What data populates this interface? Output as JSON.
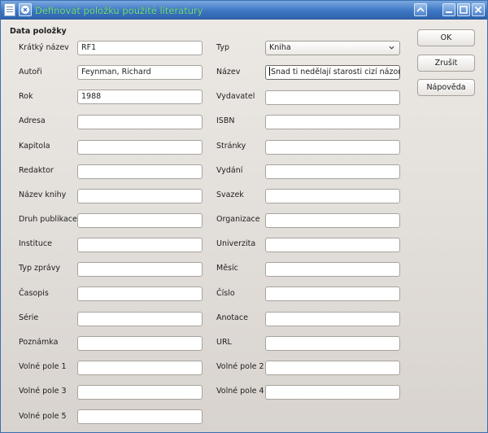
{
  "window": {
    "title": "Definovat položku použité literatury"
  },
  "section": {
    "title": "Data položky"
  },
  "left_fields": [
    {
      "label": "Krátký název",
      "value": "RF1"
    },
    {
      "label": "Autoři",
      "value": "Feynman, Richard"
    },
    {
      "label": "Rok",
      "value": "1988"
    },
    {
      "label": "Adresa",
      "value": ""
    },
    {
      "label": "Kapitola",
      "value": ""
    },
    {
      "label": "Redaktor",
      "value": ""
    },
    {
      "label": "Název knihy",
      "value": ""
    },
    {
      "label": "Druh publikace",
      "value": ""
    },
    {
      "label": "Instituce",
      "value": ""
    },
    {
      "label": "Typ zprávy",
      "value": ""
    },
    {
      "label": "Časopis",
      "value": ""
    },
    {
      "label": "Série",
      "value": ""
    },
    {
      "label": "Poznámka",
      "value": ""
    },
    {
      "label": "Volné pole 1",
      "value": ""
    },
    {
      "label": "Volné pole 3",
      "value": ""
    },
    {
      "label": "Volné pole 5",
      "value": ""
    }
  ],
  "right_fields": [
    {
      "label": "Typ",
      "value": "Kniha"
    },
    {
      "label": "Název",
      "value": "Snad ti nedělají starosti cizí názory"
    },
    {
      "label": "Vydavatel",
      "value": ""
    },
    {
      "label": "ISBN",
      "value": ""
    },
    {
      "label": "Stránky",
      "value": ""
    },
    {
      "label": "Vydání",
      "value": ""
    },
    {
      "label": "Svazek",
      "value": ""
    },
    {
      "label": "Organizace",
      "value": ""
    },
    {
      "label": "Univerzita",
      "value": ""
    },
    {
      "label": "Měsíc",
      "value": ""
    },
    {
      "label": "Číslo",
      "value": ""
    },
    {
      "label": "Anotace",
      "value": ""
    },
    {
      "label": "URL",
      "value": ""
    },
    {
      "label": "Volné pole 2",
      "value": ""
    },
    {
      "label": "Volné pole 4",
      "value": ""
    }
  ],
  "buttons": {
    "ok": "OK",
    "cancel": "Zrušit",
    "help": "Nápověda"
  },
  "icons": {
    "app": "document-icon",
    "menu": "close-circle-icon",
    "shade": "chevron-up-icon",
    "minimize": "minimize-icon",
    "maximize": "maximize-icon",
    "close": "close-icon"
  },
  "colors": {
    "titlebar": "#3f77c4",
    "title_text": "#73e07a",
    "dialog_bg": "#e0dcd8"
  }
}
